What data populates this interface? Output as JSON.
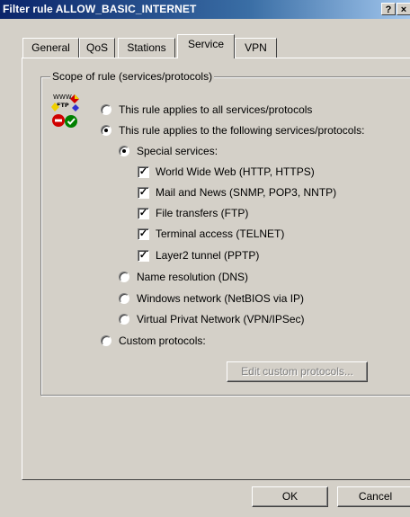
{
  "window": {
    "title": "Filter rule ALLOW_BASIC_INTERNET",
    "help_btn": "?",
    "close_btn": "×"
  },
  "tabs": [
    {
      "label": "General"
    },
    {
      "label": "QoS"
    },
    {
      "label": "Stations"
    },
    {
      "label": "Service",
      "active": true
    },
    {
      "label": "VPN"
    }
  ],
  "group": {
    "legend": "Scope of rule (services/protocols)"
  },
  "icon": {
    "name": "services-protocols-icon",
    "text": "WWW FTP"
  },
  "scope": {
    "all": {
      "label": "This rule applies to all services/protocols",
      "checked": false
    },
    "following": {
      "label": "This rule applies to the following services/protocols:",
      "checked": true
    },
    "custom": {
      "label": "Custom protocols:",
      "checked": false
    }
  },
  "special": {
    "label": "Special services:",
    "checked": true
  },
  "services": [
    {
      "label": "World Wide Web (HTTP, HTTPS)",
      "checked": true
    },
    {
      "label": "Mail and News (SNMP, POP3, NNTP)",
      "checked": true
    },
    {
      "label": "File transfers (FTP)",
      "checked": true
    },
    {
      "label": "Terminal access (TELNET)",
      "checked": true
    },
    {
      "label": "Layer2 tunnel (PPTP)",
      "checked": true
    }
  ],
  "other": [
    {
      "label": "Name resolution (DNS)",
      "checked": false
    },
    {
      "label": "Windows network (NetBIOS via IP)",
      "checked": false
    },
    {
      "label": "Virtual Privat Network (VPN/IPSec)",
      "checked": false
    }
  ],
  "buttons": {
    "edit_custom": "Edit custom protocols...",
    "ok": "OK",
    "cancel": "Cancel"
  }
}
